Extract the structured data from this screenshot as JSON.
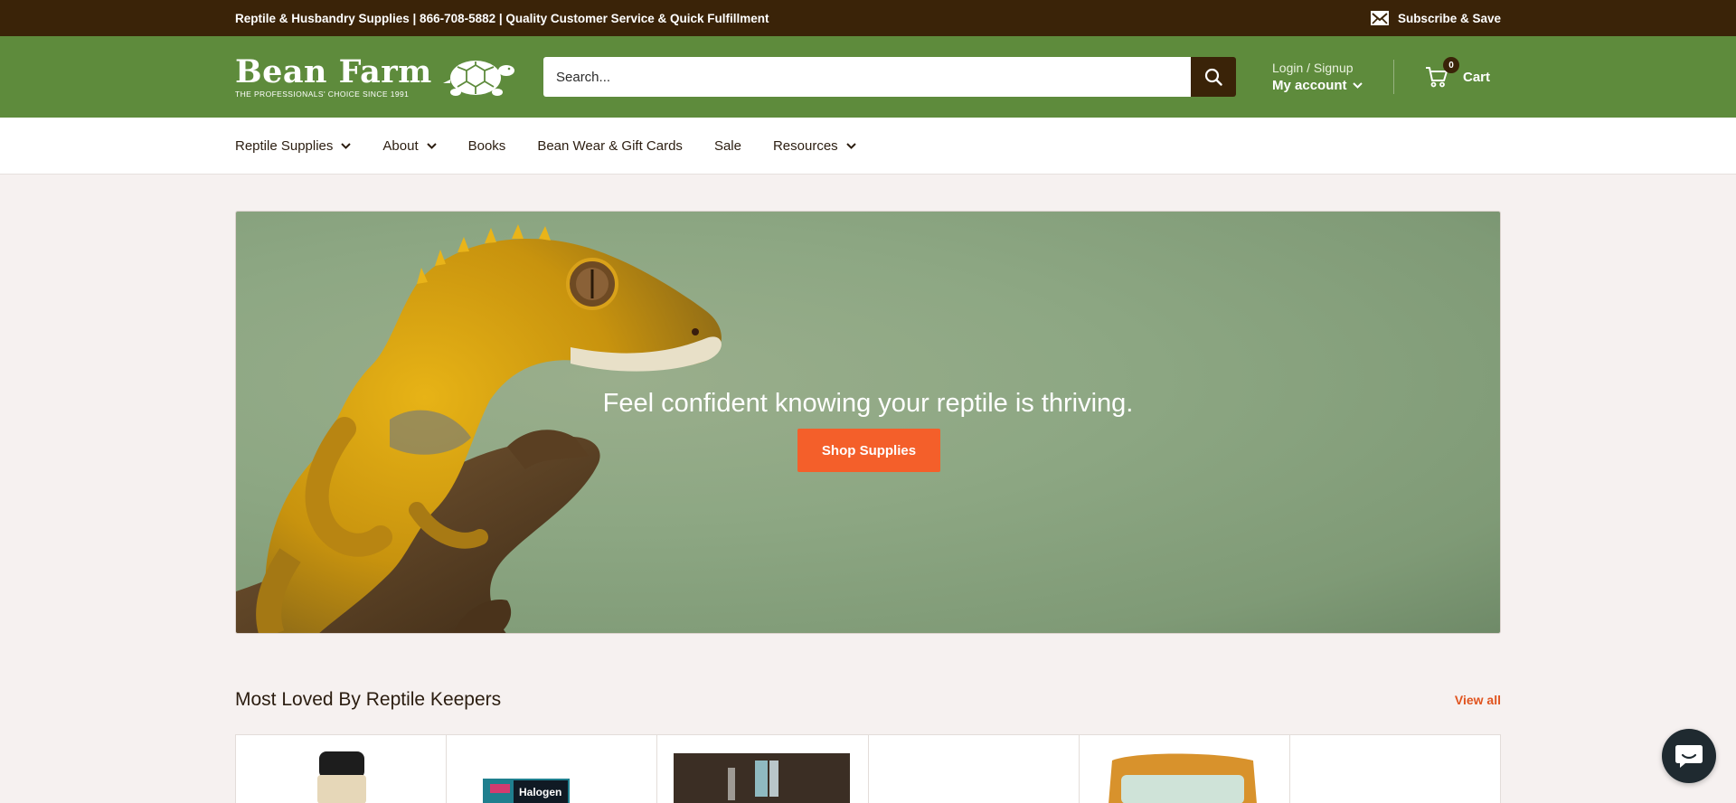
{
  "announcement": {
    "text": "Reptile & Husbandry Supplies | 866-708-5882 | Quality Customer Service & Quick Fulfillment",
    "subscribe_label": "Subscribe & Save"
  },
  "header": {
    "brand": "Bean Farm",
    "tagline": "THE PROFESSIONALS' CHOICE SINCE 1991",
    "search_placeholder": "Search...",
    "login_label": "Login / Signup",
    "account_label": "My account",
    "cart_count": "0",
    "cart_label": "Cart"
  },
  "nav": {
    "items": [
      {
        "label": "Reptile Supplies",
        "has_dropdown": true
      },
      {
        "label": "About",
        "has_dropdown": true
      },
      {
        "label": "Books",
        "has_dropdown": false
      },
      {
        "label": "Bean Wear & Gift Cards",
        "has_dropdown": false
      },
      {
        "label": "Sale",
        "has_dropdown": false
      },
      {
        "label": "Resources",
        "has_dropdown": true
      }
    ]
  },
  "hero": {
    "headline": "Feel confident knowing your reptile is thriving.",
    "cta_label": "Shop Supplies"
  },
  "featured": {
    "title": "Most Loved By Reptile Keepers",
    "view_all_label": "View all",
    "product_thumb_label": "Halogen"
  },
  "colors": {
    "announcement_bg": "#3a2308",
    "header_bg": "#5e8b3c",
    "accent": "#f45f2a",
    "link": "#e0541f"
  },
  "icons": {
    "subscribe": "envelope-icon",
    "search": "search-icon",
    "account": "chevron-down-icon",
    "cart": "cart-icon",
    "chat": "chat-icon"
  }
}
